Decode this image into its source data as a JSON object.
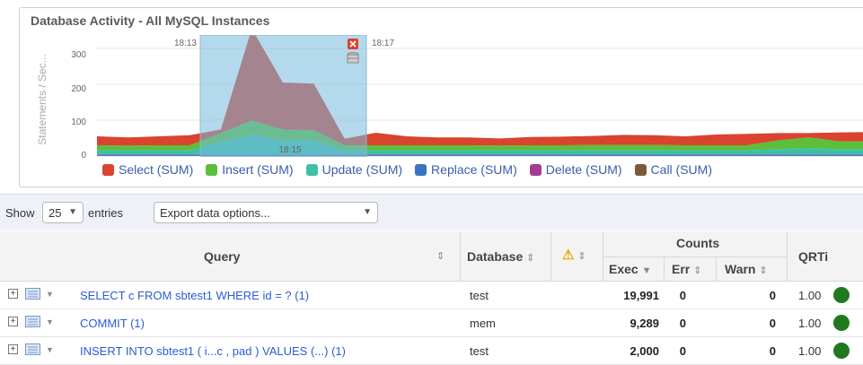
{
  "chart": {
    "title": "Database Activity - All MySQL Instances",
    "ylabel": "Statements / Sec...",
    "yticks": [
      "300",
      "200",
      "100",
      "0"
    ],
    "selection": {
      "start_label": "18:13",
      "end_label": "18:17",
      "center_label": "18:15"
    },
    "legend": [
      {
        "name": "Select (SUM)",
        "color": "#d9432f"
      },
      {
        "name": "Insert (SUM)",
        "color": "#5bbf3a"
      },
      {
        "name": "Update (SUM)",
        "color": "#3fbfa6"
      },
      {
        "name": "Replace (SUM)",
        "color": "#3a74c0"
      },
      {
        "name": "Delete (SUM)",
        "color": "#a33c95"
      },
      {
        "name": "Call (SUM)",
        "color": "#7b5a3c"
      }
    ]
  },
  "chart_data": {
    "type": "area",
    "title": "Database Activity - All MySQL Instances",
    "ylabel": "Statements / Sec...",
    "ylim": [
      0,
      330
    ],
    "stacked": true,
    "x": [
      0,
      1,
      2,
      3,
      4,
      5,
      6,
      7,
      8,
      9,
      10,
      11,
      12,
      13,
      14,
      15,
      16,
      17,
      18,
      19,
      20,
      21,
      22,
      23,
      24,
      25
    ],
    "series": [
      {
        "name": "Call (SUM)",
        "values": [
          0,
          0,
          0,
          0,
          0,
          0,
          0,
          0,
          0,
          0,
          0,
          0,
          0,
          0,
          0,
          0,
          0,
          0,
          0,
          0,
          0,
          0,
          0,
          0,
          0,
          0
        ]
      },
      {
        "name": "Delete (SUM)",
        "values": [
          1,
          1,
          1,
          1,
          1,
          1,
          1,
          1,
          1,
          1,
          1,
          1,
          1,
          1,
          1,
          1,
          1,
          1,
          1,
          1,
          1,
          1,
          1,
          1,
          1,
          1
        ]
      },
      {
        "name": "Replace (SUM)",
        "values": [
          3,
          3,
          3,
          3,
          3,
          3,
          3,
          3,
          3,
          3,
          3,
          3,
          3,
          3,
          3,
          3,
          3,
          3,
          3,
          3,
          3,
          3,
          3,
          3,
          3,
          3
        ]
      },
      {
        "name": "Update (SUM)",
        "values": [
          12,
          12,
          12,
          12,
          35,
          55,
          40,
          40,
          12,
          12,
          12,
          12,
          12,
          12,
          12,
          12,
          12,
          12,
          12,
          12,
          12,
          12,
          15,
          18,
          15,
          15
        ]
      },
      {
        "name": "Insert (SUM)",
        "values": [
          14,
          13,
          14,
          14,
          25,
          40,
          30,
          28,
          14,
          14,
          14,
          14,
          14,
          13,
          14,
          14,
          15,
          15,
          15,
          14,
          14,
          14,
          25,
          30,
          22,
          22
        ]
      },
      {
        "name": "Select (SUM)",
        "values": [
          25,
          23,
          25,
          28,
          10,
          256,
          131,
          130,
          18,
          35,
          25,
          22,
          22,
          20,
          23,
          24,
          25,
          28,
          27,
          25,
          30,
          32,
          20,
          12,
          25,
          26
        ]
      }
    ]
  },
  "toolbar": {
    "show_label": "Show",
    "entries_value": "25",
    "entries_label": "entries",
    "export_label": "Export data options..."
  },
  "table": {
    "headers": {
      "query": "Query",
      "database": "Database",
      "counts": "Counts",
      "exec": "Exec",
      "err": "Err",
      "warn": "Warn",
      "qrti": "QRTi"
    },
    "rows": [
      {
        "query": "SELECT c FROM sbtest1 WHERE id = ? (1)",
        "database": "test",
        "exec": "19,991",
        "err": "0",
        "warn": "0",
        "qrti": "1.00"
      },
      {
        "query": "COMMIT (1)",
        "database": "mem",
        "exec": "9,289",
        "err": "0",
        "warn": "0",
        "qrti": "1.00"
      },
      {
        "query": "INSERT INTO sbtest1 ( i...c , pad ) VALUES (...) (1)",
        "database": "test",
        "exec": "2,000",
        "err": "0",
        "warn": "0",
        "qrti": "1.00"
      }
    ]
  }
}
